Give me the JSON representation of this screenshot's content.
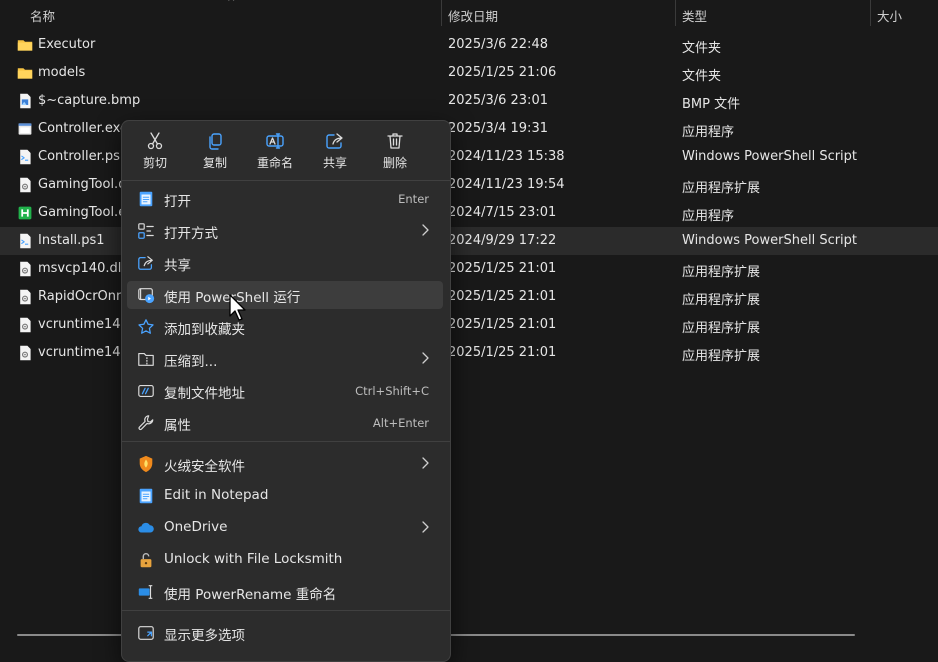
{
  "header": {
    "name": "名称",
    "date": "修改日期",
    "type": "类型",
    "size": "大小",
    "sort_arrow": "^"
  },
  "files": [
    {
      "name": "Executor",
      "date": "2025/3/6 22:48",
      "type": "文件夹",
      "icon": "folder-icon"
    },
    {
      "name": "models",
      "date": "2025/1/25 21:06",
      "type": "文件夹",
      "icon": "folder-icon"
    },
    {
      "name": "$~capture.bmp",
      "date": "2025/3/6 23:01",
      "type": "BMP 文件",
      "icon": "image-file-icon"
    },
    {
      "name": "Controller.exe",
      "date": "2025/3/4 19:31",
      "type": "应用程序",
      "icon": "exe-icon"
    },
    {
      "name": "Controller.ps1",
      "date": "2024/11/23 15:38",
      "type": "Windows PowerShell Script",
      "icon": "script-file-icon"
    },
    {
      "name": "GamingTool.d",
      "date": "2024/11/23 19:54",
      "type": "应用程序扩展",
      "icon": "dll-file-icon"
    },
    {
      "name": "GamingTool.ex",
      "date": "2024/7/15 23:01",
      "type": "应用程序",
      "icon": "green-h-app-icon"
    },
    {
      "name": "Install.ps1",
      "date": "2024/9/29 17:22",
      "type": "Windows PowerShell Script",
      "icon": "script-file-icon",
      "selected": true
    },
    {
      "name": "msvcp140.dll",
      "date": "2025/1/25 21:01",
      "type": "应用程序扩展",
      "icon": "dll-file-icon"
    },
    {
      "name": "RapidOcrOnnx",
      "date": "2025/1/25 21:01",
      "type": "应用程序扩展",
      "icon": "dll-file-icon"
    },
    {
      "name": "vcruntime140.c",
      "date": "2025/1/25 21:01",
      "type": "应用程序扩展",
      "icon": "dll-file-icon"
    },
    {
      "name": "vcruntime140_",
      "date": "2025/1/25 21:01",
      "type": "应用程序扩展",
      "icon": "dll-file-icon"
    }
  ],
  "context_menu": {
    "quick_actions": [
      {
        "label": "剪切",
        "icon": "scissors-icon"
      },
      {
        "label": "复制",
        "icon": "copy-icon"
      },
      {
        "label": "重命名",
        "icon": "rename-icon"
      },
      {
        "label": "共享",
        "icon": "share-icon"
      },
      {
        "label": "删除",
        "icon": "trash-icon"
      }
    ],
    "items": [
      {
        "label": "打开",
        "shortcut": "Enter",
        "icon": "notepad-icon"
      },
      {
        "label": "打开方式",
        "submenu": true,
        "icon": "open-with-icon"
      },
      {
        "label": "共享",
        "icon": "share-icon"
      },
      {
        "label": "使用 PowerShell 运行",
        "icon": "powershell-run-icon",
        "highlighted": true
      },
      {
        "label": "添加到收藏夹",
        "icon": "star-icon"
      },
      {
        "label": "压缩到...",
        "submenu": true,
        "icon": "zip-folder-icon"
      },
      {
        "label": "复制文件地址",
        "shortcut": "Ctrl+Shift+C",
        "icon": "copy-path-icon"
      },
      {
        "label": "属性",
        "shortcut": "Alt+Enter",
        "icon": "wrench-icon"
      },
      {
        "label": "火绒安全软件",
        "submenu": true,
        "icon": "huorong-shield-icon"
      },
      {
        "label": "Edit in Notepad",
        "icon": "notepad-icon"
      },
      {
        "label": "OneDrive",
        "submenu": true,
        "icon": "onedrive-cloud-icon"
      },
      {
        "label": "Unlock with File Locksmith",
        "icon": "padlock-icon"
      },
      {
        "label": "使用 PowerRename 重命名",
        "icon": "powerrename-icon"
      },
      {
        "label": "显示更多选项",
        "icon": "more-options-icon"
      }
    ]
  },
  "colors": {
    "background": "#191919",
    "menu_background": "#2c2c2c",
    "folder": "#f6c343",
    "accent": "#4aa3ff",
    "selected_row": "#2b2b2b"
  }
}
